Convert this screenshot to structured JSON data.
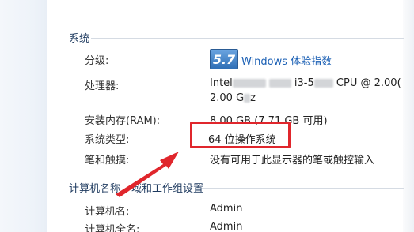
{
  "system": {
    "section_title": "系统",
    "rating_label": "分级:",
    "rating_score": "5.7",
    "rating_link": "Windows 体验指数",
    "processor_label": "处理器:",
    "processor_value_line1_a": "Intel",
    "processor_value_line1_b": "i3-5",
    "processor_value_line1_c": "CPU @ 2.00(",
    "processor_value_line2_a": "2.00 G",
    "processor_value_line2_b": "z",
    "ram_label": "安装内存(RAM):",
    "ram_value": "8.00 GB (7.71 GB 可用)",
    "type_label": "系统类型:",
    "type_value": "64 位操作系统",
    "pen_label": "笔和触摸:",
    "pen_value": "没有可用于此显示器的笔或触控输入"
  },
  "computer": {
    "section_title_a": "计算机名称",
    "section_title_b": "域和工作组设置",
    "name_label": "计算机名:",
    "name_value": "Admin",
    "fullname_label": "计算机全名:",
    "fullname_value": "Admin"
  },
  "colors": {
    "highlight": "#e0262c",
    "link": "#1a5fb4"
  }
}
